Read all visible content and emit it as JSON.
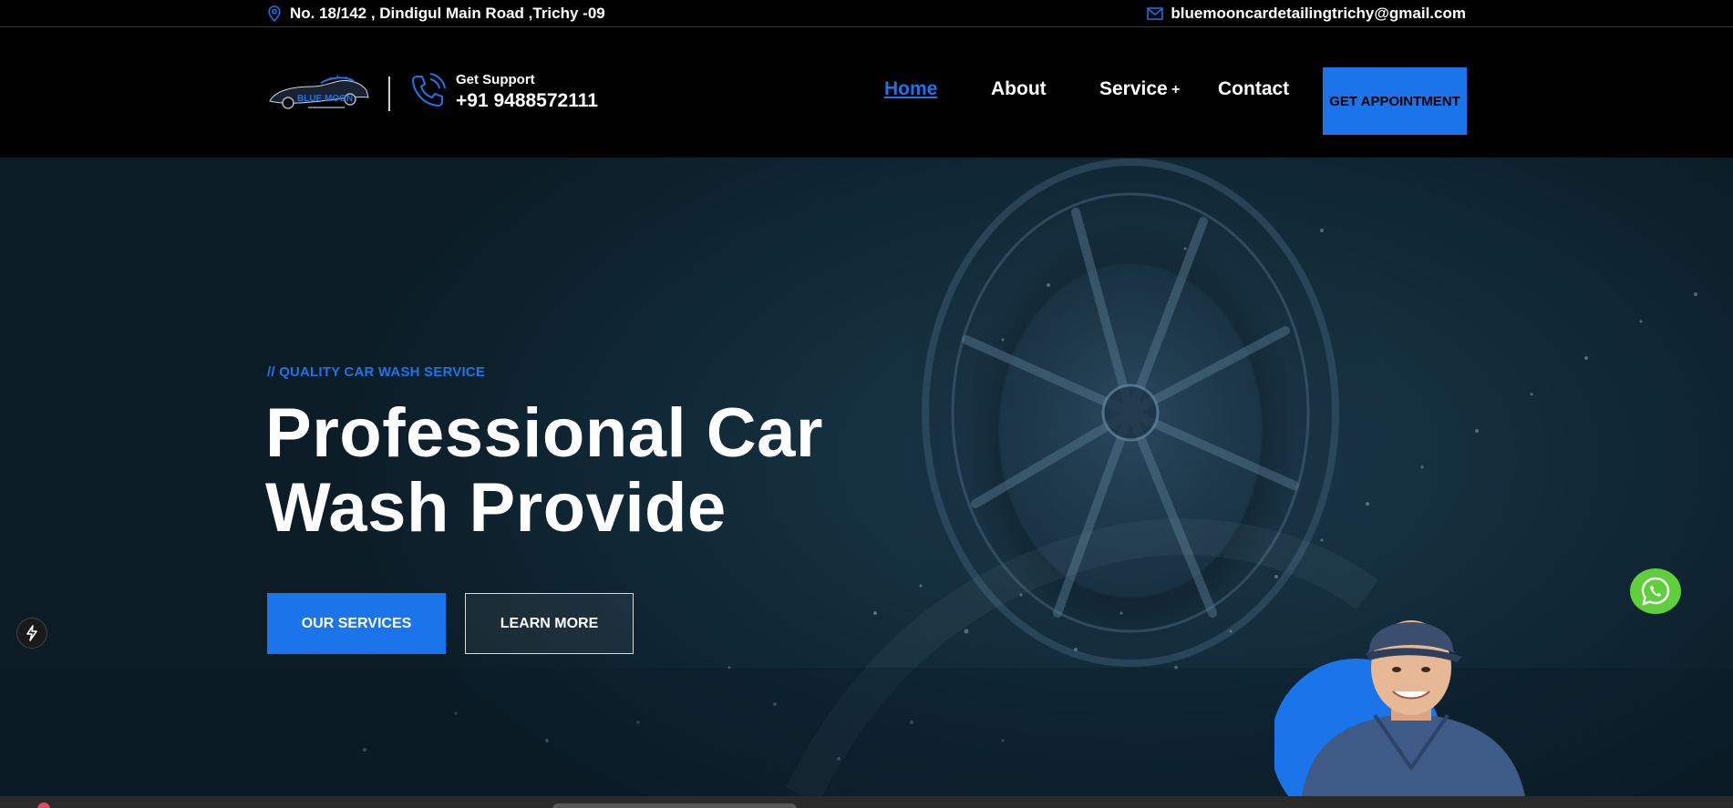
{
  "topbar": {
    "address": "No. 18/142 , Dindigul Main Road ,Trichy -09",
    "email": "bluemooncardetailingtrichy@gmail.com"
  },
  "header": {
    "logo_text": "BLUE MOON",
    "support_label": "Get Support",
    "support_phone": "+91 9488572111",
    "nav": [
      {
        "label": "Home",
        "active": true
      },
      {
        "label": "About",
        "active": false
      },
      {
        "label": "Service",
        "active": false
      },
      {
        "label": "Contact",
        "active": false
      }
    ],
    "service_expand": "+",
    "appointment_button": "GET APPOINTMENT"
  },
  "hero": {
    "kicker": "// QUALITY CAR WASH SERVICE",
    "title_line1": "Professional Car",
    "title_line2": "Wash Provide",
    "primary_button": "OUR SERVICES",
    "secondary_button": "LEARN MORE"
  },
  "colors": {
    "accent": "#1b74ea",
    "whatsapp": "#5fd03c",
    "background": "#000000"
  },
  "icons": {
    "address": "map-pin-icon",
    "email": "envelope-icon",
    "phone": "phone-ringing-icon",
    "chat": "whatsapp-icon",
    "widget": "lightning-bolt-icon"
  }
}
